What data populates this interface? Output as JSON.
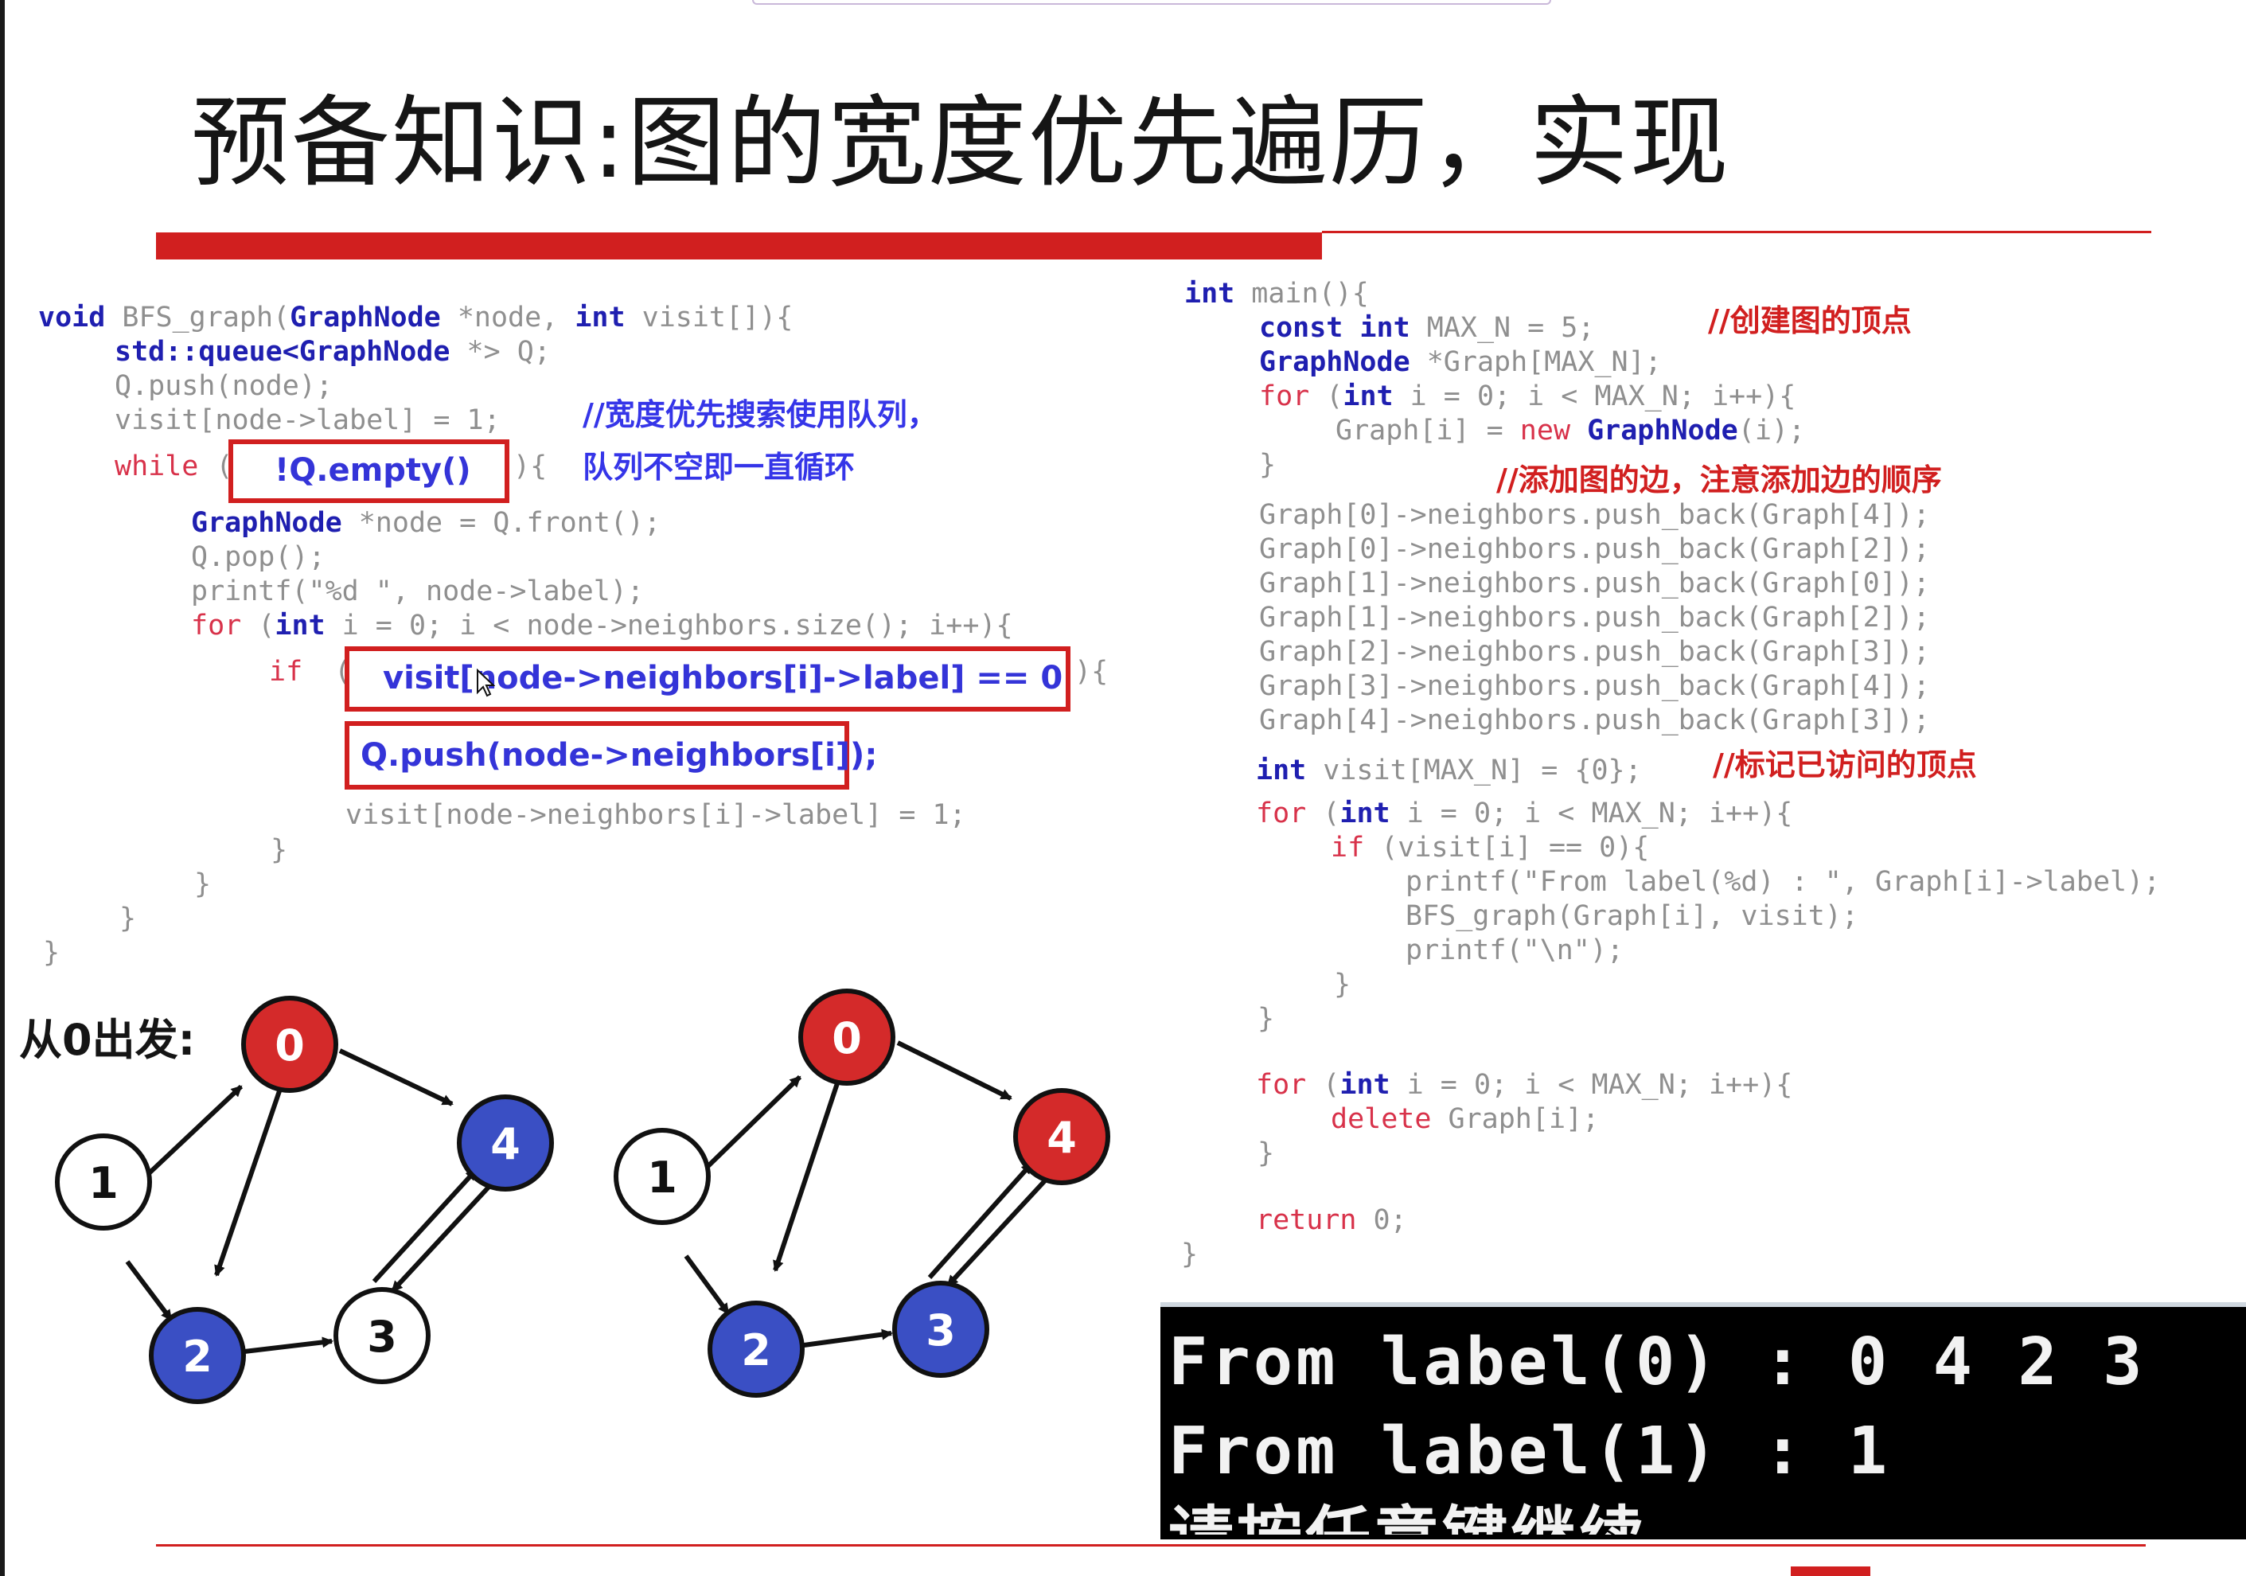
{
  "title": "预备知识:图的宽度优先遍历，实现",
  "bfs_code": {
    "line1": {
      "kw_void": "void",
      "fn": " BFS_graph(",
      "t1": "GraphNode",
      "p1": " *node, ",
      "kw_int": "int",
      "p2": " visit[]){"
    },
    "line2": {
      "t": "std::queue<GraphNode",
      "rest": " *> Q;"
    },
    "line3": "Q.push(node);",
    "line4": "visit[node->label] = 1;",
    "comment1": "//宽度优先搜索使用队列，",
    "line5_kw": "while",
    "line5_open": "(",
    "line5_close": "){",
    "box1": "!Q.empty()",
    "comment2": "队列不空即一直循环",
    "line6": {
      "t": "GraphNode",
      "rest": " *node = Q.front();"
    },
    "line7": "Q.pop();",
    "line8": "printf(\"%d \", node->label);",
    "line9": {
      "kw_for": "for",
      "open": " (",
      "kw_int": "int",
      "rest": " i = 0; i < node->neighbors.size(); i++){"
    },
    "line10_kw": "if",
    "line10_open": "(",
    "line10_close": "){",
    "box2": "visit[node->neighbors[i]->label] == 0",
    "box3": "Q.push(node->neighbors[i]);",
    "line13": "visit[node->neighbors[i]->label] = 1;",
    "close1": "}",
    "close2": "}",
    "close3": "}",
    "close4": "}"
  },
  "main_code": {
    "l1": {
      "kw": "int",
      "rest": " main(){"
    },
    "l2": {
      "kw1": "const int",
      "rest": " MAX_N = 5;"
    },
    "c1": "//创建图的顶点",
    "l3": {
      "t": "GraphNode",
      "rest": " *Graph[MAX_N];"
    },
    "l4": {
      "kw_for": "for",
      "open": " (",
      "kw_int": "int",
      "rest": " i = 0; i < MAX_N; i++){"
    },
    "l5": {
      "pre": "Graph[i] = ",
      "kw_new": "new",
      "sp": " ",
      "t": "GraphNode",
      "rest": "(i);"
    },
    "l6": "}",
    "c2": "//添加图的边，注意添加边的顺序",
    "edges": [
      "Graph[0]->neighbors.push_back(Graph[4]);",
      "Graph[0]->neighbors.push_back(Graph[2]);",
      "Graph[1]->neighbors.push_back(Graph[0]);",
      "Graph[1]->neighbors.push_back(Graph[2]);",
      "Graph[2]->neighbors.push_back(Graph[3]);",
      "Graph[3]->neighbors.push_back(Graph[4]);",
      "Graph[4]->neighbors.push_back(Graph[3]);"
    ],
    "l14": {
      "kw": "int",
      "rest": " visit[MAX_N] = {0};"
    },
    "c3": "//标记已访问的顶点",
    "l15": {
      "kw_for": "for",
      "open": " (",
      "kw_int": "int",
      "rest": " i = 0; i < MAX_N; i++){"
    },
    "l16": {
      "kw_if": "if",
      "rest": " (visit[i] == 0){"
    },
    "l17": "printf(\"From label(%d) : \", Graph[i]->label);",
    "l18": "BFS_graph(Graph[i], visit);",
    "l19": "printf(\"\\n\");",
    "l20": "}",
    "l21": "}",
    "l22": {
      "kw_for": "for",
      "open": " (",
      "kw_int": "int",
      "rest": " i = 0; i < MAX_N; i++){"
    },
    "l23": {
      "kw_del": "delete",
      "rest": " Graph[i];"
    },
    "l24": "}",
    "l25": {
      "kw_ret": "return",
      "rest": " 0;"
    },
    "l26": "}"
  },
  "start_label": "从0出发:",
  "graph_left": {
    "nodes": [
      "0",
      "1",
      "2",
      "3",
      "4"
    ]
  },
  "graph_right": {
    "nodes": [
      "0",
      "1",
      "2",
      "3",
      "4"
    ]
  },
  "terminal": {
    "line1": "From label(0) : 0 4 2 3",
    "line2": "From label(1) : 1",
    "line3": "请按任意键继续"
  },
  "colors": {
    "visited": "#d42a2a",
    "queued": "#3a4fc4",
    "unvisited": "#ffffff",
    "accent": "#d11f1f",
    "keyword": "#1f1fb0",
    "comment": "#3535e8"
  }
}
